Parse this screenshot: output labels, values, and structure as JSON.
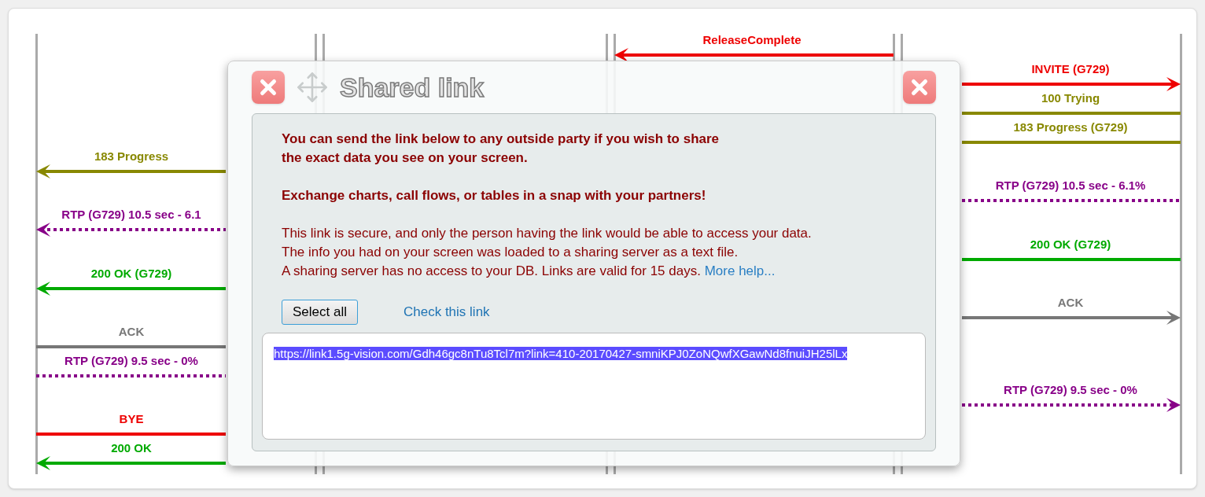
{
  "messages": [
    {
      "label": "ReleaseComplete",
      "kind": "solid",
      "color": "#ee0000"
    },
    {
      "label": "INVITE (G729)",
      "kind": "solid",
      "color": "#ee0000"
    },
    {
      "label": "100 Trying",
      "kind": "solid",
      "color": "#888800"
    },
    {
      "label": "183 Progress (G729)",
      "kind": "solid",
      "color": "#888800"
    },
    {
      "label": "183 Progress",
      "kind": "solid",
      "color": "#888800"
    },
    {
      "label": "RTP (G729) 10.5 sec - 6.1%",
      "kind": "dotted",
      "color": "#880088"
    },
    {
      "label": "RTP (G729) 10.5 sec - 6.1",
      "kind": "dotted",
      "color": "#880088"
    },
    {
      "label": "200 OK (G729)",
      "kind": "solid",
      "color": "#00aa00"
    },
    {
      "label": "200 OK (G729)",
      "kind": "solid",
      "color": "#00aa00"
    },
    {
      "label": "ACK",
      "kind": "solid",
      "color": "#777777"
    },
    {
      "label": "ACK",
      "kind": "solid",
      "color": "#777777"
    },
    {
      "label": "RTP (G729) 9.5 sec - 0%",
      "kind": "dotted",
      "color": "#880088"
    },
    {
      "label": "RTP (G729) 9.5 sec - 0%",
      "kind": "dotted",
      "color": "#880088"
    },
    {
      "label": "BYE",
      "kind": "solid",
      "color": "#ee0000"
    },
    {
      "label": "200 OK",
      "kind": "solid",
      "color": "#00aa00"
    }
  ],
  "dialog": {
    "title": "Shared link",
    "intro": "You can send the link below to any outside party if you wish to share\nthe exact data you see on your screen.",
    "slogan": "Exchange charts, call flows, or tables in a snap with your partners!",
    "info": "This link is secure, and only the person having the link would be able to access your data.\nThe info you had on your screen was loaded to a sharing server as a text file.\nA sharing server has no access to your DB. Links are valid for 15 days.",
    "help_link": "More help...",
    "select_button": "Select all",
    "check_link": "Check this link",
    "url": {
      "value": "https://link1.5g-vision.com/Gdh46gc8nTu8Tcl7m?link=410-20170427-smniKPJ0ZoNQwfXGawNd8fnuiJH25lLx",
      "selected": true
    }
  }
}
